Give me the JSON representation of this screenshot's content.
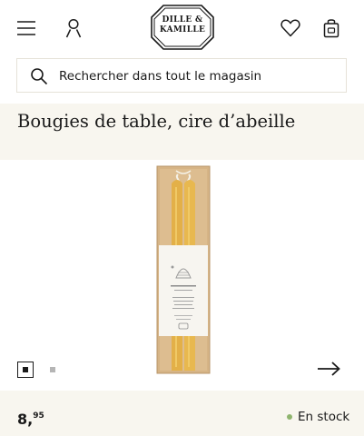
{
  "header": {
    "logo": {
      "line1": "DILLE &",
      "line2": "KAMILLE"
    },
    "icons": [
      "menu-icon",
      "account-icon",
      "wishlist-heart-icon",
      "shopping-bag-icon"
    ]
  },
  "search": {
    "placeholder": "Rechercher dans tout le magasin",
    "value": ""
  },
  "product": {
    "title": "Bougies de table, cire d’abeille",
    "price_main": "8,",
    "price_cents": "95",
    "stock_text": "En stock",
    "package_label": "Dille & Kamille"
  },
  "gallery": {
    "image_count": 2,
    "active_index": 1
  },
  "colors": {
    "band_bg": "#f8f6ef",
    "stock_dot": "#8fb56e",
    "candle": "#e3b048",
    "text": "#1a1a1a"
  }
}
